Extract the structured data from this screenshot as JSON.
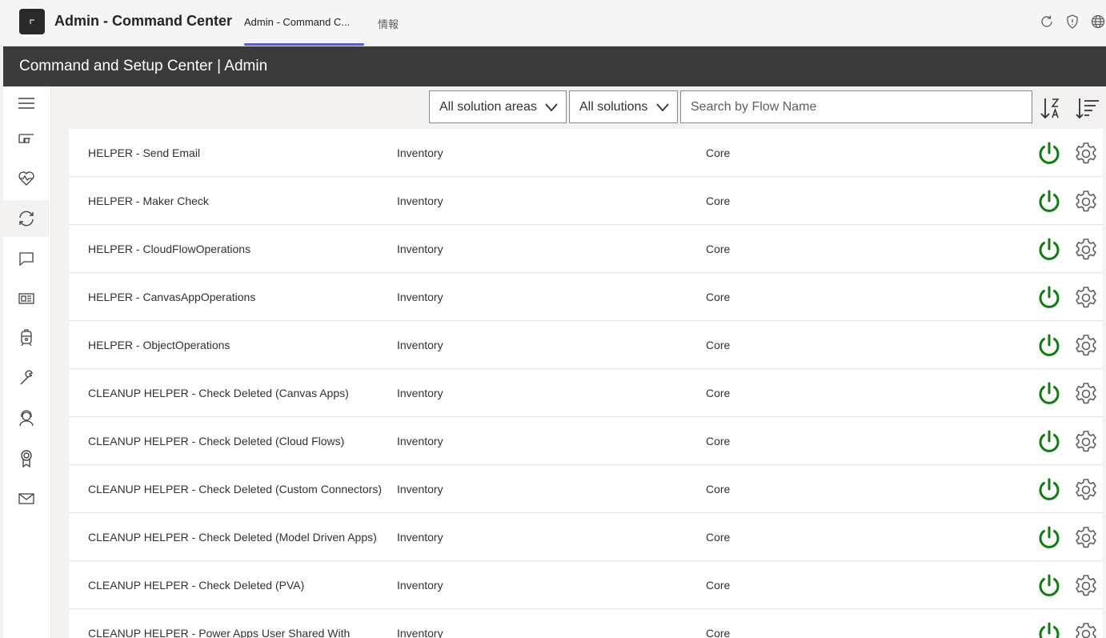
{
  "header": {
    "app_title": "Admin - Command Center",
    "tabs": [
      {
        "label": "Admin - Command C...",
        "active": true
      },
      {
        "label": "情報",
        "active": false
      }
    ],
    "accent_color": "#5b5fc7"
  },
  "title_bar": {
    "text": "Command and Setup Center | Admin"
  },
  "left_nav": {
    "items": [
      {
        "icon": "hamburger-menu-icon"
      },
      {
        "icon": "dashboard-icon"
      },
      {
        "icon": "heart-pulse-icon"
      },
      {
        "icon": "sync-icon",
        "active": true
      },
      {
        "icon": "chat-icon"
      },
      {
        "icon": "news-icon"
      },
      {
        "icon": "train-icon"
      },
      {
        "icon": "wrench-icon"
      },
      {
        "icon": "support-agent-icon"
      },
      {
        "icon": "award-ribbon-icon"
      },
      {
        "icon": "mail-icon"
      }
    ]
  },
  "filters": {
    "solution_area": "All solution areas",
    "solution": "All solutions",
    "search_placeholder": "Search by Flow Name",
    "search_value": ""
  },
  "flows": [
    {
      "name": "HELPER - Send Email",
      "area": "Inventory",
      "solution": "Core"
    },
    {
      "name": "HELPER - Maker Check",
      "area": "Inventory",
      "solution": "Core"
    },
    {
      "name": "HELPER - CloudFlowOperations",
      "area": "Inventory",
      "solution": "Core"
    },
    {
      "name": "HELPER - CanvasAppOperations",
      "area": "Inventory",
      "solution": "Core"
    },
    {
      "name": "HELPER - ObjectOperations",
      "area": "Inventory",
      "solution": "Core"
    },
    {
      "name": "CLEANUP HELPER - Check Deleted (Canvas Apps)",
      "area": "Inventory",
      "solution": "Core"
    },
    {
      "name": "CLEANUP HELPER - Check Deleted (Cloud Flows)",
      "area": "Inventory",
      "solution": "Core"
    },
    {
      "name": "CLEANUP HELPER - Check Deleted (Custom Connectors)",
      "area": "Inventory",
      "solution": "Core"
    },
    {
      "name": "CLEANUP HELPER - Check Deleted (Model Driven Apps)",
      "area": "Inventory",
      "solution": "Core"
    },
    {
      "name": "CLEANUP HELPER - Check Deleted (PVA)",
      "area": "Inventory",
      "solution": "Core"
    },
    {
      "name": "CLEANUP HELPER - Power Apps User Shared With",
      "area": "Inventory",
      "solution": "Core"
    }
  ],
  "colors": {
    "power_on": "#107c10",
    "settings": "#605e5c"
  }
}
